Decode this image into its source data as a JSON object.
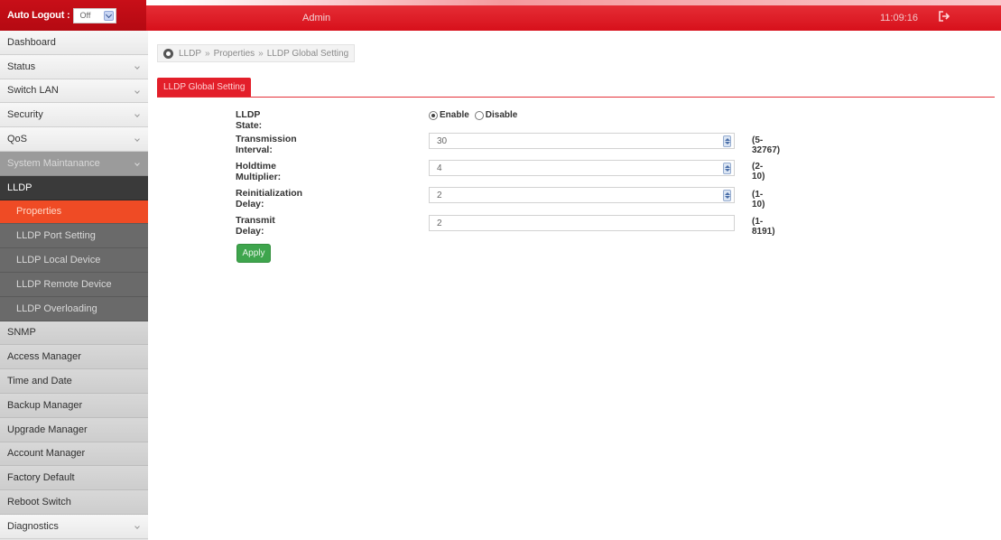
{
  "header": {
    "auto_logout_label": "Auto Logout :",
    "auto_logout_value": "Off",
    "user": "Admin",
    "time": "11:09:16",
    "logout_icon": "logout-icon",
    "accent": "#d7101b"
  },
  "sidebar": {
    "items": [
      {
        "label": "Dashboard"
      },
      {
        "label": "Status"
      },
      {
        "label": "Switch LAN"
      },
      {
        "label": "Security"
      },
      {
        "label": "QoS"
      },
      {
        "label": "System Maintanance"
      },
      {
        "label": "LLDP"
      },
      {
        "label": "Properties"
      },
      {
        "label": "LLDP Port Setting"
      },
      {
        "label": "LLDP Local Device"
      },
      {
        "label": "LLDP Remote Device"
      },
      {
        "label": "LLDP Overloading"
      },
      {
        "label": "SNMP"
      },
      {
        "label": "Access Manager"
      },
      {
        "label": "Time and Date"
      },
      {
        "label": "Backup Manager"
      },
      {
        "label": "Upgrade Manager"
      },
      {
        "label": "Account Manager"
      },
      {
        "label": "Factory Default"
      },
      {
        "label": "Reboot Switch"
      },
      {
        "label": "Diagnostics"
      }
    ]
  },
  "breadcrumb": {
    "items": [
      "LLDP",
      "Properties",
      "LLDP Global Setting"
    ],
    "separator": "»"
  },
  "tab": {
    "label": "LLDP Global Setting"
  },
  "form": {
    "state_label": "LLDP State:",
    "enable_label": "Enable",
    "disable_label": "Disable",
    "selected": "Enable",
    "tx_interval_label": "Transmission Interval:",
    "tx_interval_value": "30",
    "tx_interval_range": "(5-32767)",
    "holdtime_label": "Holdtime Multiplier:",
    "holdtime_value": "4",
    "holdtime_range": "(2-10)",
    "reinit_label": "Reinitialization Delay:",
    "reinit_value": "2",
    "reinit_range": "(1-10)",
    "tx_delay_label": "Transmit Delay:",
    "tx_delay_value": "2",
    "tx_delay_range": "(1-8191)",
    "apply_label": "Apply"
  }
}
